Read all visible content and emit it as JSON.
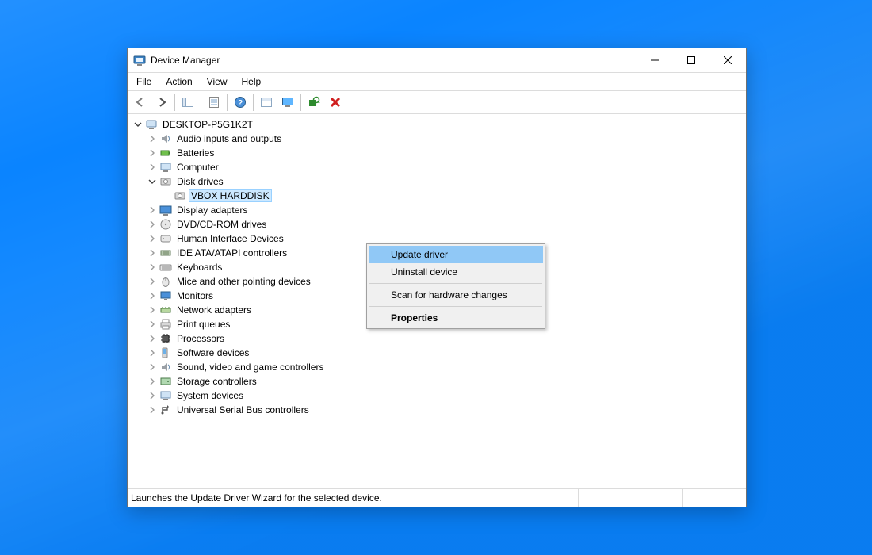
{
  "window": {
    "title": "Device Manager"
  },
  "menu": {
    "file": "File",
    "action": "Action",
    "view": "View",
    "help": "Help"
  },
  "toolbar": {
    "back": "back",
    "forward": "forward",
    "show_hide_console_tree": "show-hide-console-tree",
    "properties": "properties",
    "help": "help",
    "update_driver": "update-driver",
    "monitor": "monitor",
    "scan": "scan",
    "uninstall": "uninstall"
  },
  "tree": {
    "root": "DESKTOP-P5G1K2T",
    "items": [
      {
        "label": "Audio inputs and outputs",
        "icon": "speaker"
      },
      {
        "label": "Batteries",
        "icon": "battery"
      },
      {
        "label": "Computer",
        "icon": "computer"
      },
      {
        "label": "Disk drives",
        "icon": "disk",
        "expanded": true,
        "selected_child": "VBOX HARDDISK"
      },
      {
        "label": "Display adapters",
        "icon": "display"
      },
      {
        "label": "DVD/CD-ROM drives",
        "icon": "dvd"
      },
      {
        "label": "Human Interface Devices",
        "icon": "hid"
      },
      {
        "label": "IDE ATA/ATAPI controllers",
        "icon": "ide"
      },
      {
        "label": "Keyboards",
        "icon": "keyboard"
      },
      {
        "label": "Mice and other pointing devices",
        "icon": "mouse"
      },
      {
        "label": "Monitors",
        "icon": "monitor"
      },
      {
        "label": "Network adapters",
        "icon": "network"
      },
      {
        "label": "Print queues",
        "icon": "printer"
      },
      {
        "label": "Processors",
        "icon": "cpu"
      },
      {
        "label": "Software devices",
        "icon": "software"
      },
      {
        "label": "Sound, video and game controllers",
        "icon": "sound"
      },
      {
        "label": "Storage controllers",
        "icon": "storage"
      },
      {
        "label": "System devices",
        "icon": "system"
      },
      {
        "label": "Universal Serial Bus controllers",
        "icon": "usb"
      }
    ]
  },
  "contextmenu": {
    "update_driver": "Update driver",
    "uninstall_device": "Uninstall device",
    "scan": "Scan for hardware changes",
    "properties": "Properties"
  },
  "statusbar": {
    "text": "Launches the Update Driver Wizard for the selected device."
  }
}
